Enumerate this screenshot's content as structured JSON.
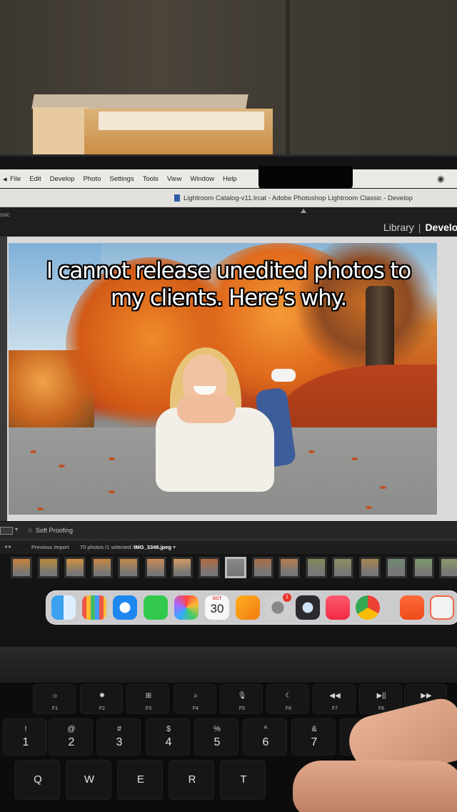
{
  "menubar": {
    "items": [
      "File",
      "Edit",
      "Develop",
      "Photo",
      "Settings",
      "Tools",
      "View",
      "Window",
      "Help"
    ]
  },
  "window": {
    "title": "Lightroom Catalog-v11.lrcat - Adobe Photoshop Lightroom Classic - Develop"
  },
  "toolbar": {
    "left_cut": "ssic"
  },
  "modules": {
    "library": "Library",
    "separator": "|",
    "develop": "Develo"
  },
  "caption": {
    "line1": "I cannot release unedited photos to",
    "line2": "my clients. Here’s why."
  },
  "bottom_toolbar": {
    "soft_proofing": "Soft Proofing"
  },
  "filmstrip_bar": {
    "source": "Previous Import",
    "count": "70 photos /1 selected /",
    "filename": "IMG_3348.jpeg",
    "dropdown": "▾"
  },
  "dock": {
    "calendar_month": "OCT",
    "calendar_day": "30",
    "badge": "1",
    "apps": [
      "finder-icon",
      "launchpad-icon",
      "safari-icon",
      "messages-icon",
      "photos-icon",
      "calendar-icon",
      "pages-icon",
      "system-settings-icon",
      "quicktime-icon",
      "music-icon",
      "chrome-icon",
      "brave-icon",
      "mail-icon"
    ]
  },
  "keyboard": {
    "function_row": [
      {
        "sym": "☼",
        "label": "F1"
      },
      {
        "sym": "✹",
        "label": "F2"
      },
      {
        "sym": "⊞",
        "label": "F3"
      },
      {
        "sym": "⌕",
        "label": "F4"
      },
      {
        "sym": "🎙",
        "label": "F5"
      },
      {
        "sym": "☾",
        "label": "F6"
      },
      {
        "sym": "◀◀",
        "label": "F7"
      },
      {
        "sym": "▶||",
        "label": "F8"
      },
      {
        "sym": "▶▶",
        "label": "F9"
      }
    ],
    "number_row": [
      {
        "sym": "!",
        "digit": "1"
      },
      {
        "sym": "@",
        "digit": "2"
      },
      {
        "sym": "#",
        "digit": "3"
      },
      {
        "sym": "$",
        "digit": "4"
      },
      {
        "sym": "%",
        "digit": "5"
      },
      {
        "sym": "^",
        "digit": "6"
      },
      {
        "sym": "&",
        "digit": "7"
      },
      {
        "sym": "*",
        "digit": ""
      }
    ],
    "letter_row": [
      "Q",
      "W",
      "E",
      "R",
      "T"
    ]
  },
  "colors": {
    "menubar_bg": "#eceae6",
    "app_bg": "#2d2d2d",
    "accent_badge": "#e8342a"
  }
}
